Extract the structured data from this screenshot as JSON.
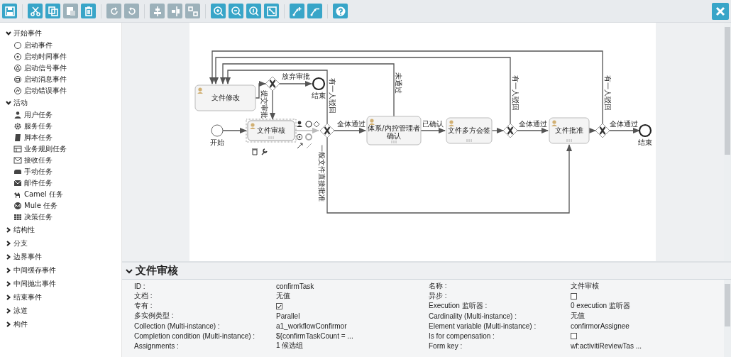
{
  "toolbar": {
    "tool_groups": [
      [
        {
          "kind": "save",
          "disabled": false
        }
      ],
      [
        {
          "kind": "cut",
          "disabled": false
        },
        {
          "kind": "copy",
          "disabled": false
        },
        {
          "kind": "paste",
          "disabled": true
        },
        {
          "kind": "delete",
          "disabled": false
        }
      ],
      [
        {
          "kind": "redo",
          "disabled": true
        },
        {
          "kind": "undo",
          "disabled": true
        }
      ],
      [
        {
          "kind": "align",
          "disabled": true
        },
        {
          "kind": "center",
          "disabled": true
        },
        {
          "kind": "resize",
          "disabled": true
        }
      ],
      [
        {
          "kind": "zoomin",
          "disabled": false
        },
        {
          "kind": "zoomout",
          "disabled": false
        },
        {
          "kind": "zoomactual",
          "disabled": false
        },
        {
          "kind": "fit",
          "disabled": false
        }
      ],
      [
        {
          "kind": "addpoint",
          "disabled": false
        },
        {
          "kind": "removepoint",
          "disabled": false
        }
      ],
      [
        {
          "kind": "help",
          "disabled": false
        }
      ]
    ]
  },
  "sidebar": {
    "groups": [
      {
        "label": "开始事件",
        "expanded": true,
        "items": [
          {
            "label": "启动事件",
            "kind": "start"
          },
          {
            "label": "启动时间事件",
            "kind": "timer"
          },
          {
            "label": "启动信号事件",
            "kind": "signal"
          },
          {
            "label": "启动消息事件",
            "kind": "message"
          },
          {
            "label": "启动错误事件",
            "kind": "error"
          }
        ]
      },
      {
        "label": "活动",
        "expanded": true,
        "items": [
          {
            "label": "用户任务",
            "kind": "user"
          },
          {
            "label": "服务任务",
            "kind": "service"
          },
          {
            "label": "脚本任务",
            "kind": "script"
          },
          {
            "label": "业务规则任务",
            "kind": "rule"
          },
          {
            "label": "接收任务",
            "kind": "receive"
          },
          {
            "label": "手动任务",
            "kind": "manual"
          },
          {
            "label": "邮件任务",
            "kind": "mail"
          },
          {
            "label": "Camel 任务",
            "kind": "camel"
          },
          {
            "label": "Mule 任务",
            "kind": "mule"
          },
          {
            "label": "决策任务",
            "kind": "decision"
          }
        ]
      },
      {
        "label": "结构性",
        "expanded": false
      },
      {
        "label": "分支",
        "expanded": false
      },
      {
        "label": "边界事件",
        "expanded": false
      },
      {
        "label": "中间缓存事件",
        "expanded": false
      },
      {
        "label": "中间抛出事件",
        "expanded": false
      },
      {
        "label": "结束事件",
        "expanded": false
      },
      {
        "label": "泳道",
        "expanded": false
      },
      {
        "label": "构件",
        "expanded": false
      }
    ]
  },
  "diagram": {
    "nodes": [
      {
        "kind": "task",
        "label": "文件修改",
        "selected": false
      },
      {
        "kind": "gateway",
        "selected": false
      },
      {
        "kind": "end",
        "label": "结束",
        "selected": false
      },
      {
        "kind": "start",
        "label": "开始",
        "selected": false
      },
      {
        "kind": "task",
        "label": "文件审核",
        "selected": true
      },
      {
        "kind": "gateway",
        "selected": false
      },
      {
        "kind": "task",
        "label": "体系/内控管理者确认",
        "selected": false
      },
      {
        "kind": "task",
        "label": "文件多方会签",
        "selected": false
      },
      {
        "kind": "gateway",
        "selected": false
      },
      {
        "kind": "task",
        "label": "文件批准",
        "selected": false
      },
      {
        "kind": "gateway",
        "selected": false
      },
      {
        "kind": "end",
        "label": "结束",
        "selected": false
      }
    ],
    "flow_labels": [
      {
        "label": "放弃审批",
        "vertical": false
      },
      {
        "label": "提交审批",
        "vertical": true
      },
      {
        "label": "有一人驳回",
        "vertical": true
      },
      {
        "label": "全体通过",
        "vertical": false
      },
      {
        "label": "未通过",
        "vertical": true
      },
      {
        "label": "已确认",
        "vertical": false
      },
      {
        "label": "有一人驳回",
        "vertical": true
      },
      {
        "label": "全体通过",
        "vertical": false
      },
      {
        "label": "有一人驳回",
        "vertical": true
      },
      {
        "label": "全体通过",
        "vertical": false
      },
      {
        "label": "一般文件直接批准",
        "vertical": true
      }
    ]
  },
  "properties": {
    "title": "文件审核",
    "expanded": true,
    "rows": [
      {
        "label": "ID :",
        "kind": "text",
        "value": "confirmTask"
      },
      {
        "label": "名称 :",
        "kind": "text",
        "value": "文件审核"
      },
      {
        "label": "文档 :",
        "kind": "text",
        "value": "无值"
      },
      {
        "label": "异步 :",
        "kind": "checkbox",
        "checked": false
      },
      {
        "label": "专有 :",
        "kind": "checkbox",
        "checked": true
      },
      {
        "label": "Execution 监听器 :",
        "kind": "text",
        "value": "0 execution 监听器"
      },
      {
        "label": "多实例类型 :",
        "kind": "text",
        "value": "Parallel"
      },
      {
        "label": "Cardinality (Multi-instance) :",
        "kind": "text",
        "value": "无值"
      },
      {
        "label": "Collection (Multi-instance) :",
        "kind": "text",
        "value": "a1_workflowConfirmor"
      },
      {
        "label": "Element variable (Multi-instance) :",
        "kind": "text",
        "value": "confirmorAssignee"
      },
      {
        "label": "Completion condition (Multi-instance) :",
        "kind": "text",
        "value": "${confirmTaskCount = ..."
      },
      {
        "label": "Is for compensation :",
        "kind": "checkbox",
        "checked": false
      },
      {
        "label": "Assignments :",
        "kind": "text",
        "value": "1 候选组"
      },
      {
        "label": "Form key :",
        "kind": "text",
        "value": "wf:activitiReviewTas ..."
      }
    ]
  }
}
